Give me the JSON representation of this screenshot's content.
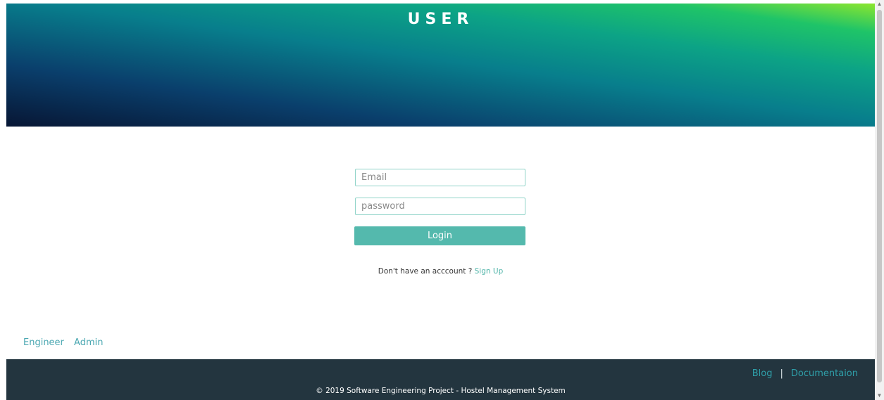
{
  "header": {
    "title": "USER"
  },
  "login_form": {
    "email_placeholder": "Email",
    "password_placeholder": "password",
    "login_label": "Login",
    "signup_prompt": "Don't have an acccount ? ",
    "signup_link": "Sign Up"
  },
  "role_links": {
    "engineer": "Engineer",
    "admin": "Admin"
  },
  "footer": {
    "blog": "Blog",
    "separator": "|",
    "documentation": "Documentaion",
    "copyright": "© 2019 Software Engineering Project - Hostel Management System"
  },
  "colors": {
    "accent": "#54b9ad",
    "link": "#4aa7b1",
    "footer_bg": "#23353f"
  },
  "icons": {
    "scroll_up": "triangle-up",
    "scroll_down": "triangle-down"
  }
}
